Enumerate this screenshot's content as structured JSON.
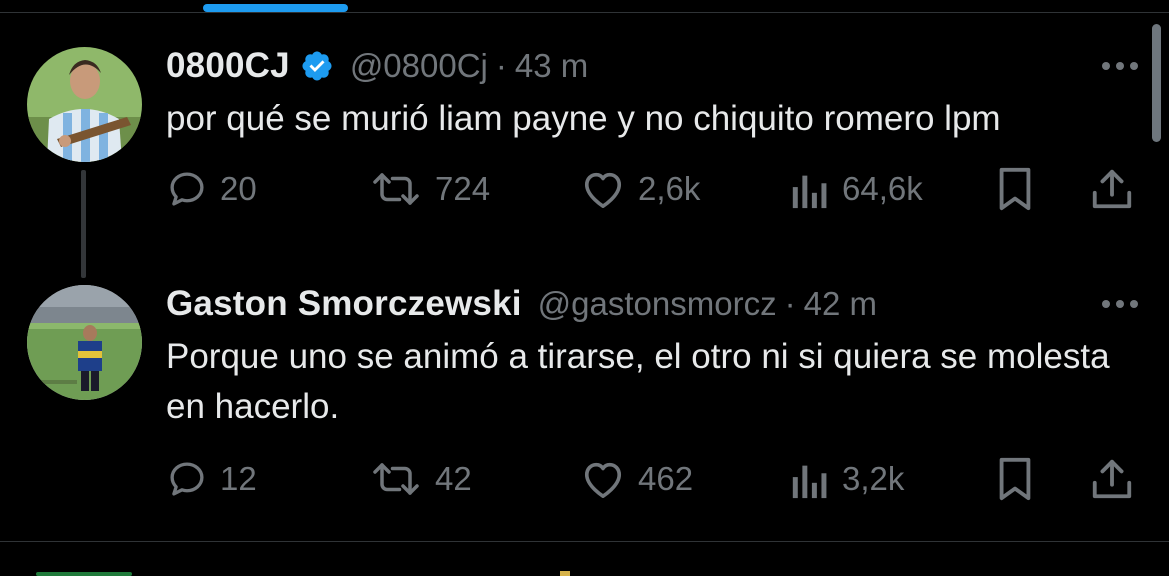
{
  "tweets": [
    {
      "name": "0800CJ",
      "verified": true,
      "handle": "@0800Cj",
      "separator": "·",
      "time": "43 m",
      "text": "por qué se murió liam payne y no chiquito romero lpm",
      "stats": {
        "replies": "20",
        "retweets": "724",
        "likes": "2,6k",
        "views": "64,6k"
      }
    },
    {
      "name": "Gaston Smorczewski",
      "verified": false,
      "handle": "@gastonsmorcz",
      "separator": "·",
      "time": "42 m",
      "text": "Porque uno se animó a tirarse, el otro ni si quiera se molesta en hacerlo.",
      "stats": {
        "replies": "12",
        "retweets": "42",
        "likes": "462",
        "views": "3,2k"
      }
    }
  ],
  "icons": {
    "reply": "reply-icon",
    "retweet": "retweet-icon",
    "like": "heart-icon",
    "views": "views-icon",
    "bookmark": "bookmark-icon",
    "share": "share-icon",
    "more": "more-icon",
    "verified": "verified-badge-icon"
  },
  "colors": {
    "background": "#000000",
    "text": "#e7e9ea",
    "secondary": "#71767b",
    "accent": "#1d9bf0",
    "divider": "#2f3336"
  }
}
